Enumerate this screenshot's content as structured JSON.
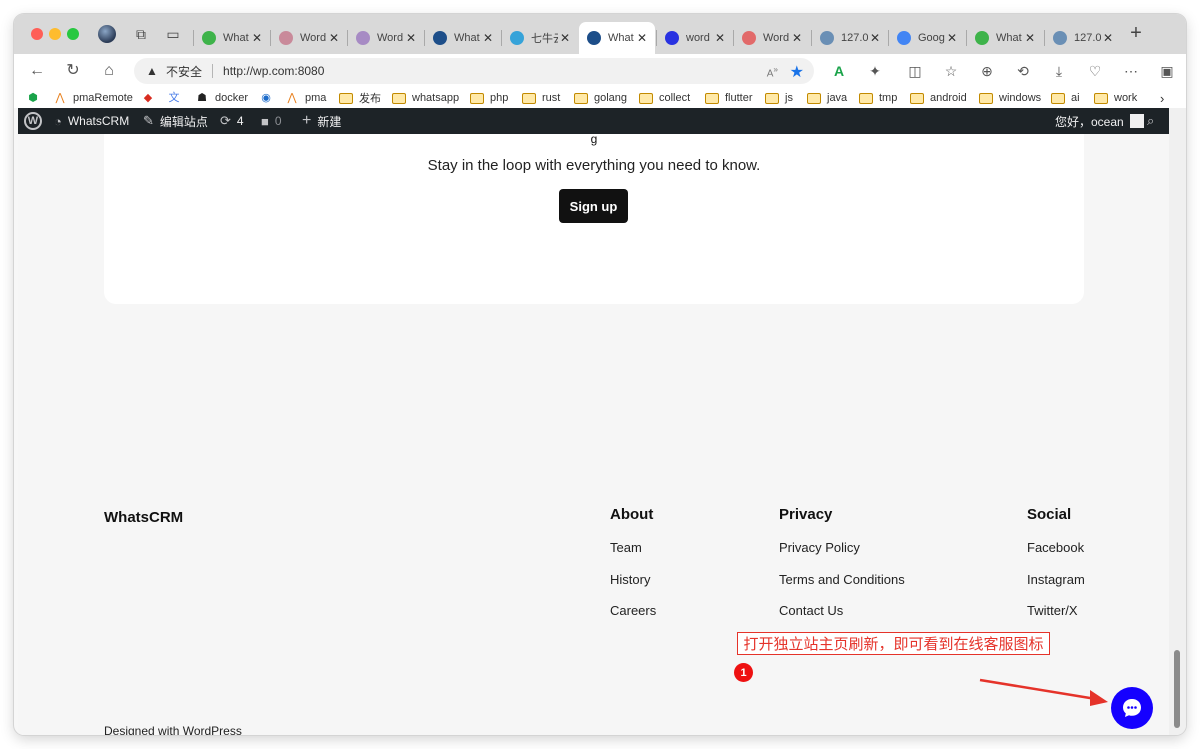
{
  "tabs": [
    {
      "label": "What",
      "favicon": "whatsapp-icon",
      "color": "#3eb34a",
      "active": false
    },
    {
      "label": "Word",
      "favicon": "wordpress-icon",
      "color": "#c98a9a",
      "active": false
    },
    {
      "label": "Word",
      "favicon": "wordpress-icon",
      "color": "#a78bc4",
      "active": false
    },
    {
      "label": "What",
      "favicon": "wordpress-icon",
      "color": "#1d4e89",
      "active": false
    },
    {
      "label": "七牛云",
      "favicon": "qiniu-icon",
      "color": "#36a3d9",
      "active": false
    },
    {
      "label": "What",
      "favicon": "wordpress-icon",
      "color": "#1d4e89",
      "active": true
    },
    {
      "label": "word",
      "favicon": "baidu-icon",
      "color": "#2932e1",
      "active": false
    },
    {
      "label": "Word",
      "favicon": "wordpress-icon",
      "color": "#e26a6a",
      "active": false
    },
    {
      "label": "127.0",
      "favicon": "globe-icon",
      "color": "#6a8fb5",
      "active": false
    },
    {
      "label": "Goog",
      "favicon": "google-translate-icon",
      "color": "#4285f4",
      "active": false
    },
    {
      "label": "What",
      "favicon": "whatsapp-icon",
      "color": "#3eb34a",
      "active": false
    },
    {
      "label": "127.0",
      "favicon": "globe-icon",
      "color": "#6a8fb5",
      "active": false
    }
  ],
  "address": {
    "security": "不安全",
    "url": "http://wp.com:8080",
    "read_aloud": "A",
    "read_aloud_super": "»"
  },
  "bookmarks": [
    {
      "label": "",
      "icon": "shield-icon",
      "type": "app"
    },
    {
      "label": "pmaRemote",
      "icon": "pma-icon",
      "type": "app"
    },
    {
      "label": "",
      "icon": "redis-icon",
      "type": "app"
    },
    {
      "label": "",
      "icon": "translate-icon",
      "type": "app"
    },
    {
      "label": "docker",
      "icon": "linux-icon",
      "type": "app"
    },
    {
      "label": "",
      "icon": "edge-icon",
      "type": "app"
    },
    {
      "label": "pma",
      "icon": "pma-icon",
      "type": "app"
    },
    {
      "label": "发布",
      "type": "folder"
    },
    {
      "label": "whatsapp",
      "type": "folder"
    },
    {
      "label": "php",
      "type": "folder"
    },
    {
      "label": "rust",
      "type": "folder"
    },
    {
      "label": "golang",
      "type": "folder"
    },
    {
      "label": "collect",
      "type": "folder"
    },
    {
      "label": "flutter",
      "type": "folder"
    },
    {
      "label": "js",
      "type": "folder"
    },
    {
      "label": "java",
      "type": "folder"
    },
    {
      "label": "tmp",
      "type": "folder"
    },
    {
      "label": "android",
      "type": "folder"
    },
    {
      "label": "windows",
      "type": "folder"
    },
    {
      "label": "ai",
      "type": "folder"
    },
    {
      "label": "work",
      "type": "folder"
    }
  ],
  "adminbar": {
    "site_name": "WhatsCRM",
    "edit_site": "编辑站点",
    "updates_count": "4",
    "comments_count": "0",
    "new_label": "新建",
    "greeting": "您好，ocean"
  },
  "page": {
    "card_partial": "g",
    "tagline": "Stay in the loop with everything you need to know.",
    "signup_label": "Sign up",
    "site_name": "WhatsCRM",
    "columns": [
      {
        "title": "About",
        "links": [
          "Team",
          "History",
          "Careers"
        ]
      },
      {
        "title": "Privacy",
        "links": [
          "Privacy Policy",
          "Terms and Conditions",
          "Contact Us"
        ]
      },
      {
        "title": "Social",
        "links": [
          "Facebook",
          "Instagram",
          "Twitter/X"
        ]
      }
    ],
    "designed_prefix": "Designed with ",
    "designed_link": "WordPress"
  },
  "annotation": {
    "text": "打开独立站主页刷新，即可看到在线客服图标",
    "number": "1",
    "color": "#e5332a"
  },
  "chat_button": {
    "icon": "chat-bubble-icon",
    "color": "#1500ff"
  }
}
